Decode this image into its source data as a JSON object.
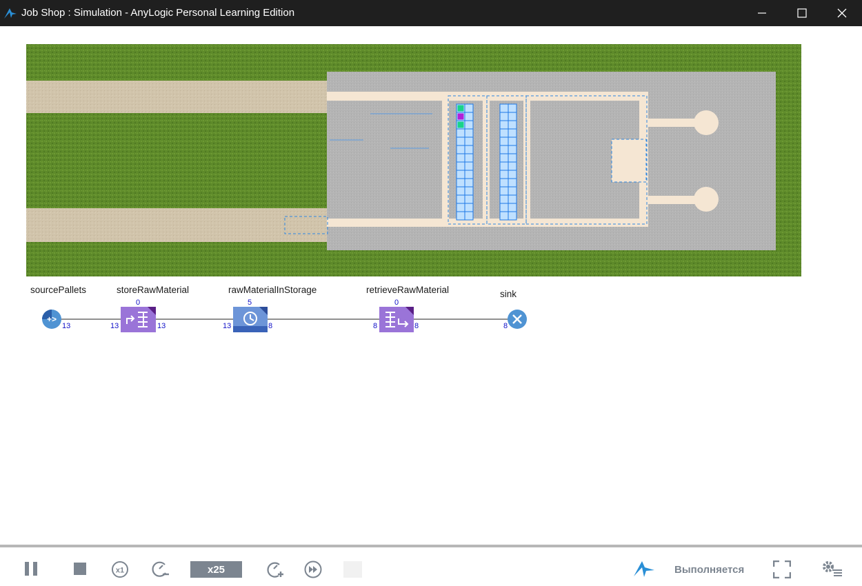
{
  "window": {
    "title": "Job Shop : Simulation - AnyLogic Personal Learning Edition",
    "controls": [
      "minimize-icon",
      "maximize-icon",
      "close-icon"
    ]
  },
  "colors": {
    "titlebar": "#1f1f1f",
    "grass": "#5e8a2a",
    "road": "#d1c4ab",
    "floor": "#b4b4b4",
    "storage": "#bfe0ff",
    "storage_grid": "#1e78e6",
    "block_purple": "#9a74d8",
    "block_blue": "#5b87d0",
    "endpoint": "#4f93d3",
    "count_text": "#1010c8",
    "toolbar_grey": "#7c8590",
    "anylogic_blue": "#2a8fd6"
  },
  "storage_cells": {
    "racks": 2,
    "rows": 14,
    "cols": 2,
    "occupied": [
      {
        "rack": 0,
        "row": 0,
        "col": 0,
        "color": "#19d38a"
      },
      {
        "rack": 0,
        "row": 1,
        "col": 0,
        "color": "#b21fd8"
      },
      {
        "rack": 0,
        "row": 2,
        "col": 0,
        "color": "#19d38a"
      }
    ]
  },
  "flowchart": {
    "blocks": [
      {
        "name": "sourcePallets",
        "kind": "source",
        "in": "",
        "out": "13",
        "top": ""
      },
      {
        "name": "storeRawMaterial",
        "kind": "store",
        "in": "13",
        "out": "13",
        "top": "0"
      },
      {
        "name": "rawMaterialInStorage",
        "kind": "delay",
        "in": "13",
        "out": "8",
        "top": "5"
      },
      {
        "name": "retrieveRawMaterial",
        "kind": "retrieve",
        "in": "8",
        "out": "8",
        "top": "0"
      },
      {
        "name": "sink",
        "kind": "sink",
        "in": "8",
        "out": "",
        "top": ""
      }
    ]
  },
  "toolbar": {
    "buttons": [
      "pause-icon",
      "stop-icon",
      "speed-x1-icon",
      "slow-down-icon",
      "speed-up-icon",
      "fast-forward-icon"
    ],
    "speed_label": "x25",
    "speed_x1_label": "x1",
    "status": "Выполняется",
    "extra_icons": [
      "anylogic-logo-icon",
      "fullscreen-icon",
      "settings-icon"
    ]
  }
}
